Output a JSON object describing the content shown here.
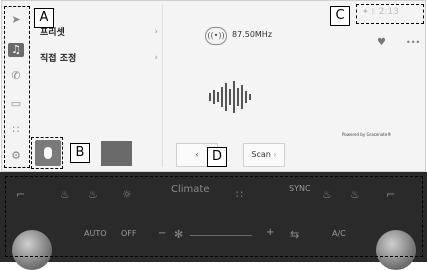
{
  "menu": {
    "items": [
      {
        "label": "프리셋"
      },
      {
        "label": "직접 조정"
      }
    ],
    "chevron": "›"
  },
  "radio": {
    "frequency": "87.50MHz",
    "powered_by": "Powered by Gracenote®",
    "scan_label": "Scan",
    "prev_glyph": "‹",
    "scan_arrow": "›"
  },
  "status": {
    "time": "2:13"
  },
  "climate": {
    "label": "Climate",
    "sync_label": "SYNC",
    "auto_label": "AUTO",
    "off_label": "OFF",
    "ac_label": "A/C",
    "minus": "−",
    "plus": "+"
  },
  "callouts": {
    "a": "A",
    "b": "B",
    "c": "C",
    "d": "D"
  }
}
